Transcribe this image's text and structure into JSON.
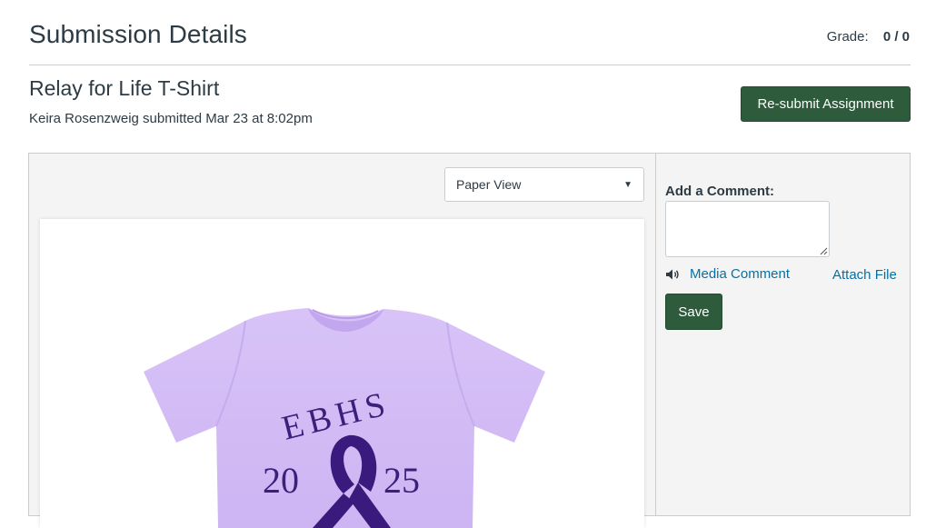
{
  "header": {
    "page_title": "Submission Details",
    "grade_label": "Grade:",
    "grade_value": "0 / 0"
  },
  "assignment": {
    "title": "Relay for Life T-Shirt",
    "submitted_line": "Keira Rosenzweig submitted Mar 23 at 8:02pm",
    "resubmit_label": "Re-submit Assignment"
  },
  "viewer": {
    "view_select_value": "Paper View",
    "image": {
      "text_top": "EBHS",
      "year_left": "20",
      "year_right": "25",
      "shirt_color": "#d6c0f6",
      "text_color": "#3b1f7a",
      "ribbon_color": "#3a1a7d"
    }
  },
  "comments": {
    "label": "Add a Comment:",
    "textarea_value": "",
    "media_comment": "Media Comment",
    "attach_file": "Attach File",
    "save_label": "Save"
  },
  "colors": {
    "accent_green": "#2e5b3c",
    "link_blue": "#0770a3",
    "text": "#2d3b45",
    "panel_bg": "#f4f4f4"
  }
}
